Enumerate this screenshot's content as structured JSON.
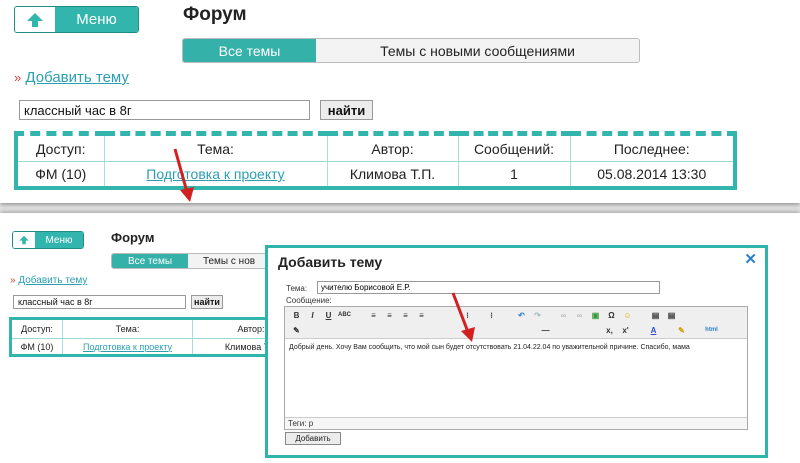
{
  "top": {
    "menu_label": "Меню",
    "page_title": "Форум",
    "tabs": [
      {
        "label": "Все темы"
      },
      {
        "label": "Темы с новыми сообщениями"
      }
    ],
    "add_topic": "Добавить тему",
    "search_value": "классный час в 8г",
    "search_button": "найти",
    "table": {
      "headers": [
        "Доступ:",
        "Тема:",
        "Автор:",
        "Сообщений:",
        "Последнее:"
      ],
      "row": [
        "ФМ (10)",
        "Подготовка к проекту",
        "Климова Т.П.",
        "1",
        "05.08.2014 13:30"
      ]
    }
  },
  "bottom": {
    "menu_label": "Меню",
    "page_title": "Форум",
    "tabs": [
      {
        "label": "Все темы"
      },
      {
        "label": "Темы с нов"
      }
    ],
    "add_topic": "Добавить тему",
    "search_value": "классный час в 8г",
    "search_button": "найти",
    "table": {
      "headers": [
        "Доступ:",
        "Тема:",
        "Автор:"
      ],
      "row": [
        "ФМ (10)",
        "Подготовка к проекту",
        "Климова Т.П"
      ]
    }
  },
  "dialog": {
    "title": "Добавить тему",
    "close_glyph": "✕",
    "topic_label": "Тема:",
    "topic_value": "учителю Борисовой Е.Р.",
    "message_label": "Сообщение:",
    "message_text": "Добрый день. Хочу Вам сообщить, что мой сын будет отсутствовать 21.04.22.04 по уважительной причине. Спасибо, мама",
    "tags_label": "Теги: p",
    "submit_label": "Добавить"
  },
  "icons": {
    "menu": "arrow-up-icon",
    "close": "close-icon",
    "annotation": "red-arrow-icon"
  },
  "colors": {
    "accent": "#31b5ad",
    "link": "#2a9fb0",
    "annotation": "#d32020"
  }
}
